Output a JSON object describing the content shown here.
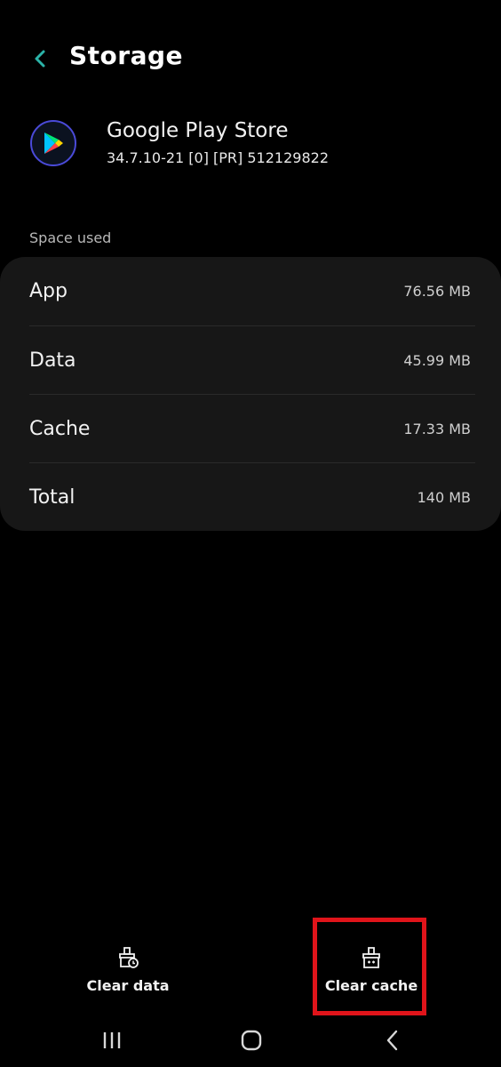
{
  "header": {
    "title": "Storage",
    "back_icon": "chevron-left-icon"
  },
  "app": {
    "name": "Google Play Store",
    "version": "34.7.10-21 [0] [PR] 512129822",
    "icon": "google-play-icon"
  },
  "space_used": {
    "label": "Space used",
    "rows": [
      {
        "label": "App",
        "value": "76.56 MB"
      },
      {
        "label": "Data",
        "value": "45.99 MB"
      },
      {
        "label": "Cache",
        "value": "17.33 MB"
      },
      {
        "label": "Total",
        "value": "140 MB"
      }
    ]
  },
  "actions": {
    "clear_data": "Clear data",
    "clear_cache": "Clear cache"
  },
  "colors": {
    "accent": "#2bb3a8",
    "highlight": "#e0141a",
    "card": "#171717",
    "background": "#000000"
  },
  "navbar": {
    "recents_icon": "recents-icon",
    "home_icon": "home-icon",
    "back_icon": "back-icon"
  }
}
